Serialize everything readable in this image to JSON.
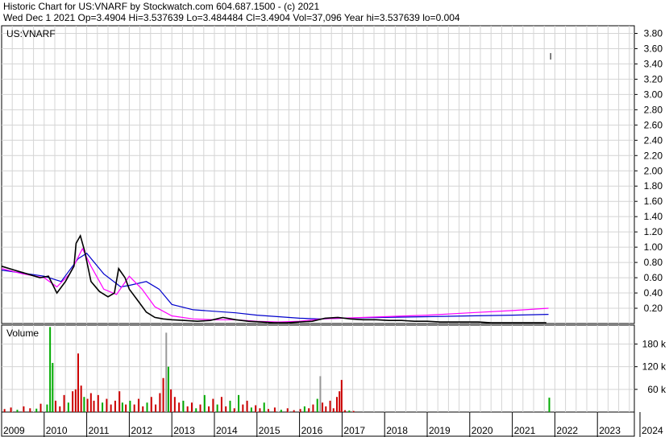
{
  "header": {
    "line1": "Historic Chart for US:VNARF by Stockwatch.com 604.687.1500 - (c) 2021",
    "line2": "Wed Dec  1 2021   Op=3.4904   Hi=3.537639   Lo=3.484484   Cl=3.4904   Vol=37,096   Year hi=3.537639   lo=0.004"
  },
  "chart_data": [
    {
      "type": "line",
      "title": "US:VNARF",
      "price_axis_ticks": [
        "3.80",
        "3.60",
        "3.40",
        "3.20",
        "3.00",
        "2.80",
        "2.60",
        "2.40",
        "2.20",
        "2.00",
        "1.80",
        "1.60",
        "1.40",
        "1.20",
        "1.00",
        "0.80",
        "0.60",
        "0.40",
        "0.20"
      ],
      "ylim": [
        0,
        3.9
      ],
      "grid": true,
      "x_axis_labels": [
        "2009",
        "2010",
        "2011",
        "2012",
        "2013",
        "2014",
        "2015",
        "2016",
        "2017",
        "2018",
        "2019",
        "2020",
        "2021",
        "2022",
        "2023",
        "2024"
      ],
      "x_start_year": 2009,
      "series": [
        {
          "color": "#000000",
          "x": [
            2009.0,
            2009.3,
            2009.6,
            2009.9,
            2010.1,
            2010.3,
            2010.5,
            2010.7,
            2010.75,
            2010.85,
            2010.95,
            2011.1,
            2011.3,
            2011.5,
            2011.65,
            2011.75,
            2011.8,
            2011.9,
            2012.0,
            2012.2,
            2012.4,
            2012.6,
            2012.8,
            2013.0,
            2013.3,
            2013.6,
            2013.9,
            2014.2,
            2014.5,
            2014.8,
            2015.1,
            2015.4,
            2015.7,
            2016.0,
            2016.3,
            2016.6,
            2016.9,
            2017.2,
            2017.5,
            2017.8,
            2018.1,
            2018.4,
            2018.7,
            2019.0,
            2019.3,
            2019.6,
            2019.9,
            2020.2,
            2020.5,
            2020.8,
            2021.1,
            2021.4,
            2021.5,
            2021.6,
            2021.7,
            2021.8,
            2021.9
          ],
          "values": [
            0.75,
            0.7,
            0.65,
            0.6,
            0.62,
            0.4,
            0.55,
            0.75,
            1.05,
            1.15,
            0.95,
            0.55,
            0.42,
            0.35,
            0.4,
            0.72,
            0.68,
            0.6,
            0.45,
            0.3,
            0.15,
            0.08,
            0.06,
            0.05,
            0.04,
            0.03,
            0.04,
            0.08,
            0.05,
            0.03,
            0.02,
            0.01,
            0.01,
            0.02,
            0.03,
            0.07,
            0.08,
            0.06,
            0.05,
            0.05,
            0.04,
            0.04,
            0.03,
            0.03,
            0.02,
            0.02,
            0.02,
            0.02,
            0.01,
            0.01,
            0.01,
            0.01,
            0.01,
            0.01,
            0.01,
            0.01,
            3.5
          ]
        },
        {
          "color": "#ff00ff",
          "x": [
            2009.0,
            2009.5,
            2010.0,
            2010.3,
            2010.6,
            2010.9,
            2011.1,
            2011.4,
            2011.7,
            2012.0,
            2012.3,
            2012.6,
            2013.0,
            2013.5,
            2014.0,
            2014.5,
            2015.0,
            2015.5,
            2016.0,
            2016.5,
            2017.0,
            2018.0,
            2019.0,
            2020.0,
            2021.0,
            2021.85
          ],
          "values": [
            0.72,
            0.65,
            0.6,
            0.48,
            0.65,
            0.98,
            0.75,
            0.45,
            0.38,
            0.62,
            0.45,
            0.22,
            0.1,
            0.06,
            0.05,
            0.05,
            0.03,
            0.02,
            0.03,
            0.06,
            0.07,
            0.09,
            0.11,
            0.14,
            0.17,
            0.2
          ]
        },
        {
          "color": "#0000cc",
          "x": [
            2009.0,
            2009.5,
            2010.0,
            2010.4,
            2010.8,
            2011.0,
            2011.4,
            2011.8,
            2012.0,
            2012.4,
            2012.7,
            2013.0,
            2013.5,
            2014.0,
            2014.5,
            2015.0,
            2015.5,
            2016.0,
            2016.5,
            2017.0,
            2018.0,
            2019.0,
            2020.0,
            2021.0,
            2021.85
          ],
          "values": [
            0.7,
            0.66,
            0.62,
            0.55,
            0.85,
            0.92,
            0.65,
            0.48,
            0.5,
            0.55,
            0.45,
            0.25,
            0.18,
            0.16,
            0.14,
            0.11,
            0.09,
            0.07,
            0.06,
            0.07,
            0.08,
            0.09,
            0.1,
            0.11,
            0.12
          ]
        }
      ]
    },
    {
      "type": "bar",
      "title": "Volume",
      "volume_axis_ticks": [
        "180 k",
        "120 k",
        "60 k"
      ],
      "ylim": [
        0,
        230000
      ],
      "bars": [
        {
          "x": 2009.05,
          "v": 8000,
          "c": "#cc0000"
        },
        {
          "x": 2009.2,
          "v": 12000,
          "c": "#cc0000"
        },
        {
          "x": 2009.35,
          "v": 6000,
          "c": "#00aa00"
        },
        {
          "x": 2009.5,
          "v": 15000,
          "c": "#cc0000"
        },
        {
          "x": 2009.65,
          "v": 10000,
          "c": "#cc0000"
        },
        {
          "x": 2009.8,
          "v": 9000,
          "c": "#00aa00"
        },
        {
          "x": 2009.9,
          "v": 22000,
          "c": "#cc0000"
        },
        {
          "x": 2010.05,
          "v": 20000,
          "c": "#00aa00"
        },
        {
          "x": 2010.12,
          "v": 225000,
          "c": "#00aa00"
        },
        {
          "x": 2010.18,
          "v": 130000,
          "c": "#00aa00"
        },
        {
          "x": 2010.25,
          "v": 30000,
          "c": "#cc0000"
        },
        {
          "x": 2010.35,
          "v": 15000,
          "c": "#cc0000"
        },
        {
          "x": 2010.45,
          "v": 45000,
          "c": "#cc0000"
        },
        {
          "x": 2010.55,
          "v": 25000,
          "c": "#00aa00"
        },
        {
          "x": 2010.65,
          "v": 55000,
          "c": "#cc0000"
        },
        {
          "x": 2010.72,
          "v": 60000,
          "c": "#cc0000"
        },
        {
          "x": 2010.78,
          "v": 155000,
          "c": "#cc0000"
        },
        {
          "x": 2010.85,
          "v": 70000,
          "c": "#cc0000"
        },
        {
          "x": 2010.92,
          "v": 40000,
          "c": "#00aa00"
        },
        {
          "x": 2011.0,
          "v": 35000,
          "c": "#cc0000"
        },
        {
          "x": 2011.08,
          "v": 50000,
          "c": "#cc0000"
        },
        {
          "x": 2011.15,
          "v": 30000,
          "c": "#cc0000"
        },
        {
          "x": 2011.25,
          "v": 45000,
          "c": "#cc0000"
        },
        {
          "x": 2011.35,
          "v": 25000,
          "c": "#00aa00"
        },
        {
          "x": 2011.45,
          "v": 35000,
          "c": "#cc0000"
        },
        {
          "x": 2011.55,
          "v": 20000,
          "c": "#cc0000"
        },
        {
          "x": 2011.65,
          "v": 30000,
          "c": "#cc0000"
        },
        {
          "x": 2011.75,
          "v": 55000,
          "c": "#cc0000"
        },
        {
          "x": 2011.82,
          "v": 25000,
          "c": "#00aa00"
        },
        {
          "x": 2011.9,
          "v": 20000,
          "c": "#cc0000"
        },
        {
          "x": 2012.0,
          "v": 30000,
          "c": "#00aa00"
        },
        {
          "x": 2012.1,
          "v": 20000,
          "c": "#cc0000"
        },
        {
          "x": 2012.2,
          "v": 35000,
          "c": "#cc0000"
        },
        {
          "x": 2012.3,
          "v": 15000,
          "c": "#cc0000"
        },
        {
          "x": 2012.4,
          "v": 25000,
          "c": "#00aa00"
        },
        {
          "x": 2012.5,
          "v": 40000,
          "c": "#cc0000"
        },
        {
          "x": 2012.6,
          "v": 20000,
          "c": "#cc0000"
        },
        {
          "x": 2012.7,
          "v": 50000,
          "c": "#cc0000"
        },
        {
          "x": 2012.78,
          "v": 90000,
          "c": "#cc0000"
        },
        {
          "x": 2012.85,
          "v": 210000,
          "c": "#999999"
        },
        {
          "x": 2012.9,
          "v": 120000,
          "c": "#00aa00"
        },
        {
          "x": 2012.96,
          "v": 60000,
          "c": "#cc0000"
        },
        {
          "x": 2013.05,
          "v": 40000,
          "c": "#cc0000"
        },
        {
          "x": 2013.15,
          "v": 25000,
          "c": "#cc0000"
        },
        {
          "x": 2013.25,
          "v": 30000,
          "c": "#00aa00"
        },
        {
          "x": 2013.35,
          "v": 15000,
          "c": "#cc0000"
        },
        {
          "x": 2013.45,
          "v": 25000,
          "c": "#cc0000"
        },
        {
          "x": 2013.55,
          "v": 10000,
          "c": "#00aa00"
        },
        {
          "x": 2013.65,
          "v": 20000,
          "c": "#cc0000"
        },
        {
          "x": 2013.75,
          "v": 45000,
          "c": "#00aa00"
        },
        {
          "x": 2013.85,
          "v": 15000,
          "c": "#cc0000"
        },
        {
          "x": 2013.95,
          "v": 35000,
          "c": "#cc0000"
        },
        {
          "x": 2014.05,
          "v": 20000,
          "c": "#00aa00"
        },
        {
          "x": 2014.15,
          "v": 40000,
          "c": "#cc0000"
        },
        {
          "x": 2014.25,
          "v": 15000,
          "c": "#cc0000"
        },
        {
          "x": 2014.35,
          "v": 30000,
          "c": "#00aa00"
        },
        {
          "x": 2014.45,
          "v": 10000,
          "c": "#cc0000"
        },
        {
          "x": 2014.55,
          "v": 45000,
          "c": "#00aa00"
        },
        {
          "x": 2014.65,
          "v": 20000,
          "c": "#cc0000"
        },
        {
          "x": 2014.75,
          "v": 30000,
          "c": "#cc0000"
        },
        {
          "x": 2014.85,
          "v": 12000,
          "c": "#00aa00"
        },
        {
          "x": 2014.95,
          "v": 18000,
          "c": "#cc0000"
        },
        {
          "x": 2015.05,
          "v": 10000,
          "c": "#cc0000"
        },
        {
          "x": 2015.15,
          "v": 25000,
          "c": "#00aa00"
        },
        {
          "x": 2015.25,
          "v": 8000,
          "c": "#cc0000"
        },
        {
          "x": 2015.4,
          "v": 12000,
          "c": "#cc0000"
        },
        {
          "x": 2015.55,
          "v": 6000,
          "c": "#00aa00"
        },
        {
          "x": 2015.7,
          "v": 10000,
          "c": "#cc0000"
        },
        {
          "x": 2015.85,
          "v": 5000,
          "c": "#cc0000"
        },
        {
          "x": 2016.0,
          "v": 8000,
          "c": "#cc0000"
        },
        {
          "x": 2016.1,
          "v": 15000,
          "c": "#00aa00"
        },
        {
          "x": 2016.2,
          "v": 10000,
          "c": "#cc0000"
        },
        {
          "x": 2016.3,
          "v": 20000,
          "c": "#cc0000"
        },
        {
          "x": 2016.4,
          "v": 35000,
          "c": "#00aa00"
        },
        {
          "x": 2016.47,
          "v": 95000,
          "c": "#999999"
        },
        {
          "x": 2016.52,
          "v": 25000,
          "c": "#cc0000"
        },
        {
          "x": 2016.6,
          "v": 15000,
          "c": "#cc0000"
        },
        {
          "x": 2016.7,
          "v": 30000,
          "c": "#cc0000"
        },
        {
          "x": 2016.78,
          "v": 10000,
          "c": "#cc0000"
        },
        {
          "x": 2016.86,
          "v": 40000,
          "c": "#cc0000"
        },
        {
          "x": 2016.92,
          "v": 55000,
          "c": "#cc0000"
        },
        {
          "x": 2016.97,
          "v": 85000,
          "c": "#cc0000"
        },
        {
          "x": 2017.05,
          "v": 5000,
          "c": "#cc0000"
        },
        {
          "x": 2017.15,
          "v": 4000,
          "c": "#00aa00"
        },
        {
          "x": 2017.25,
          "v": 3000,
          "c": "#cc0000"
        },
        {
          "x": 2021.85,
          "v": 38000,
          "c": "#00aa00"
        }
      ]
    }
  ]
}
